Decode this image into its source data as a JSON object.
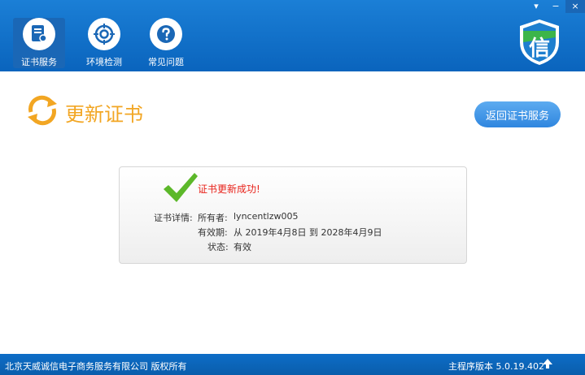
{
  "header": {
    "nav": [
      {
        "label": "证书服务"
      },
      {
        "label": "环境检测"
      },
      {
        "label": "常见问题"
      }
    ],
    "logo_char": "信",
    "window_buttons": {
      "menu": "▾",
      "minimize": "−",
      "close": "×"
    }
  },
  "page": {
    "title": "更新证书",
    "back_button": "返回证书服务"
  },
  "result": {
    "message": "证书更新成功!",
    "detail_label": "证书详情:",
    "owner_label": "所有者:",
    "owner_value": "lyncentlzw005",
    "validity_label": "有效期:",
    "validity_value": "从 2019年4月8日 到 2028年4月9日",
    "status_label": "状态:",
    "status_value": "有效"
  },
  "footer": {
    "copyright": "北京天威诚信电子商务服务有限公司 版权所有",
    "version": "主程序版本 5.0.19.402"
  },
  "colors": {
    "primary_blue": "#0a64bd",
    "accent_orange": "#f2a623",
    "success_green": "#1c9b25",
    "error_red": "#e8231b"
  }
}
